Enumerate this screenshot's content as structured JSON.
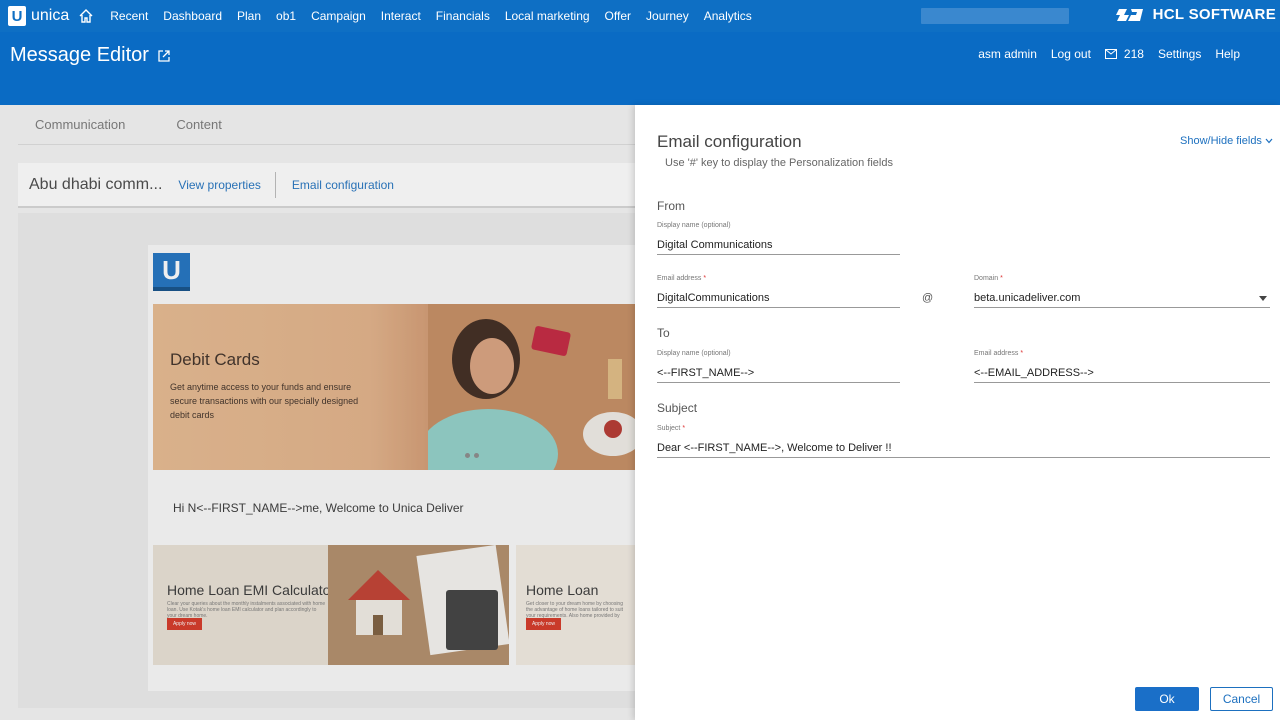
{
  "topnav": {
    "logo_text": "unica",
    "items": [
      "Recent",
      "Dashboard",
      "Plan",
      "ob1",
      "Campaign",
      "Interact",
      "Financials",
      "Local marketing",
      "Offer",
      "Journey",
      "Analytics"
    ],
    "brand": "HCL SOFTWARE"
  },
  "header": {
    "title": "Message Editor",
    "user": "asm admin",
    "logout": "Log out",
    "mail_count": "218",
    "settings": "Settings",
    "help": "Help"
  },
  "editor": {
    "tabs": [
      "Communication",
      "Content"
    ],
    "comm_title": "Abu dhabi comm...",
    "view_properties": "View properties",
    "email_configuration": "Email configuration",
    "email_logo": "U",
    "hero_title": "Debit Cards",
    "hero_text": "Get anytime access to your funds and ensure secure transactions with our specially designed debit cards",
    "greeting": "Hi N<--FIRST_NAME-->me, Welcome to Unica Deliver",
    "card1_title": "Home Loan EMI Calculator",
    "card1_text": "Clear your queries about the monthly instalments associated with home loan. Use Kotak's home loan EMI calculator and plan accordingly to your dream home.",
    "card1_button": "Apply now",
    "card2_title": "Home Loan",
    "card2_text": "Get closer to your dream home by choosing the advantage of home loans tailored to suit your requirements. Also home provided by Kotak.",
    "card2_button": "Apply now"
  },
  "panel": {
    "title": "Email configuration",
    "hint": "Use '#' key to display the Personalization fields",
    "show_hide": "Show/Hide fields",
    "from_section": "From",
    "from_display_label": "Display name (optional)",
    "from_display_value": "Digital Communications",
    "email_label": "Email address",
    "email_value": "DigitalCommunications",
    "at_sign": "@",
    "domain_label": "Domain",
    "domain_value": "beta.unicadeliver.com",
    "to_section": "To",
    "to_display_label": "Display name (optional)",
    "to_display_value": "<--FIRST_NAME-->",
    "to_email_label": "Email address",
    "to_email_value": "<--EMAIL_ADDRESS-->",
    "subject_section": "Subject",
    "subject_label": "Subject",
    "subject_value": "Dear <--FIRST_NAME-->, Welcome to Deliver !!",
    "ok": "Ok",
    "cancel": "Cancel",
    "required_mark": "*"
  },
  "colors": {
    "brand_blue": "#0e6fc4",
    "link_blue": "#1d70bf",
    "cta_red": "#d4311f"
  }
}
